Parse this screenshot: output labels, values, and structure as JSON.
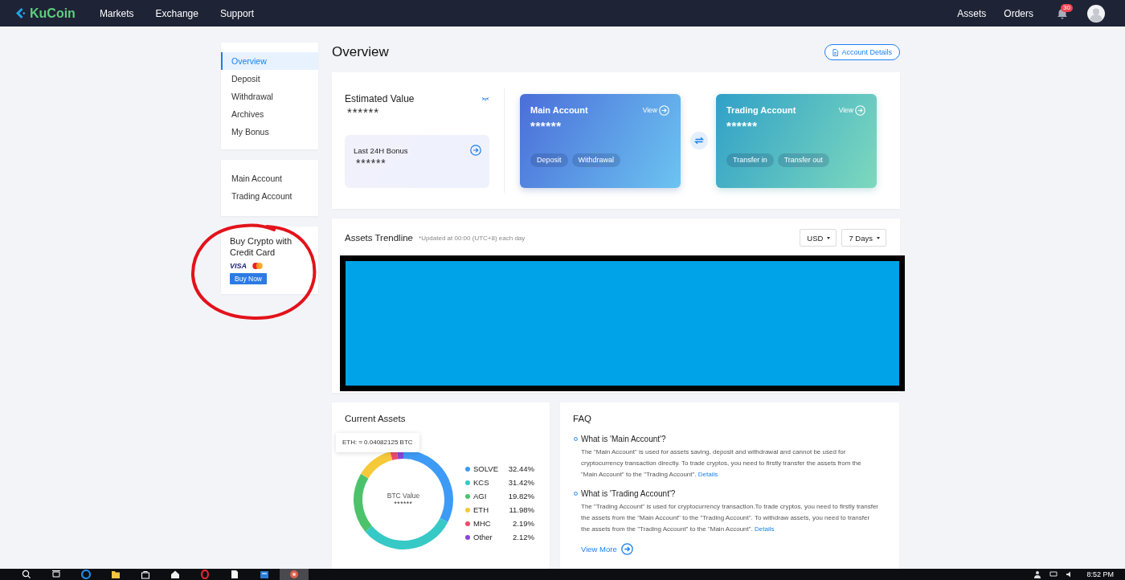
{
  "nav": {
    "logo": "KuCoin",
    "links": [
      {
        "label": "Markets"
      },
      {
        "label": "Exchange"
      },
      {
        "label": "Support"
      }
    ],
    "right_links": [
      {
        "label": "Assets"
      },
      {
        "label": "Orders"
      }
    ],
    "notifications": "30"
  },
  "sidebar": {
    "menus": [
      {
        "items": [
          {
            "label": "Overview",
            "selected": true
          },
          {
            "label": "Deposit",
            "selected": false
          },
          {
            "label": "Withdrawal",
            "selected": false
          },
          {
            "label": "Archives",
            "selected": false
          },
          {
            "label": "My Bonus",
            "selected": false
          }
        ]
      },
      {
        "items": [
          {
            "label": "Main Account",
            "selected": false
          },
          {
            "label": "Trading Account",
            "selected": false
          }
        ]
      }
    ],
    "promo": {
      "title": "Buy Crypto with Credit Card",
      "payment_logo": "VISA",
      "button": "Buy Now",
      "circled": true
    }
  },
  "page_title": "Overview",
  "account_details_button": "Account Details",
  "summary": {
    "estimated_label": "Estimated Value",
    "estimated_value": "******",
    "bonus_label": "Last 24H Bonus",
    "bonus_value": "******"
  },
  "accounts": [
    {
      "kind": "main",
      "title": "Main Account",
      "view": "View",
      "value": "******",
      "actions": [
        "Deposit",
        "Withdrawal"
      ]
    },
    {
      "kind": "trading",
      "title": "Trading Account",
      "view": "View",
      "value": "******",
      "actions": [
        "Transfer in",
        "Transfer out"
      ]
    }
  ],
  "trendline": {
    "title": "Assets Trendline",
    "note": "*Updated at 00:00 (UTC+8) each day",
    "currency": "USD",
    "period": "7 Days",
    "redacted": true
  },
  "current_assets": {
    "title": "Current Assets",
    "tooltip": "ETH: ≈ 0.04082125 BTC",
    "center_label": "BTC Value",
    "center_value": "******",
    "chart_data": {
      "type": "donut",
      "categories": [
        "SOLVE",
        "KCS",
        "AGI",
        "ETH",
        "MHC",
        "Other"
      ],
      "values": [
        32.44,
        31.42,
        19.82,
        11.98,
        2.19,
        2.12
      ],
      "colors": [
        "#3d9bf6",
        "#36c9c6",
        "#4cc36b",
        "#f5c93a",
        "#ec4a6a",
        "#8a45d6"
      ],
      "legend": "right",
      "value_labels": [
        "32.44%",
        "31.42%",
        "19.82%",
        "11.98%",
        "2.19%",
        "2.12%"
      ]
    }
  },
  "faq": {
    "title": "FAQ",
    "items": [
      {
        "question": "What is 'Main Account'?",
        "answer": "The \"Main Account\" is used for assets saving, deposit and withdrawal and cannot be used for cryptocurrency transaction directly. To trade cryptos, you need to firstly transfer the assets from the \"Main Account\" to the \"Trading Account\".",
        "link": "Details"
      },
      {
        "question": "What is 'Trading Account'?",
        "answer": "The \"Trading Account\" is used for cryptocurrency transaction.To trade cryptos, you need to firstly transfer the assets from the \"Main Account\" to the \"Trading Account\". To withdraw assets, you need to transfer the assets from the \"Trading Account\" to the \"Main Account\".",
        "link": "Details"
      }
    ],
    "more": "View More"
  },
  "taskbar": {
    "time": "8:52 PM"
  }
}
